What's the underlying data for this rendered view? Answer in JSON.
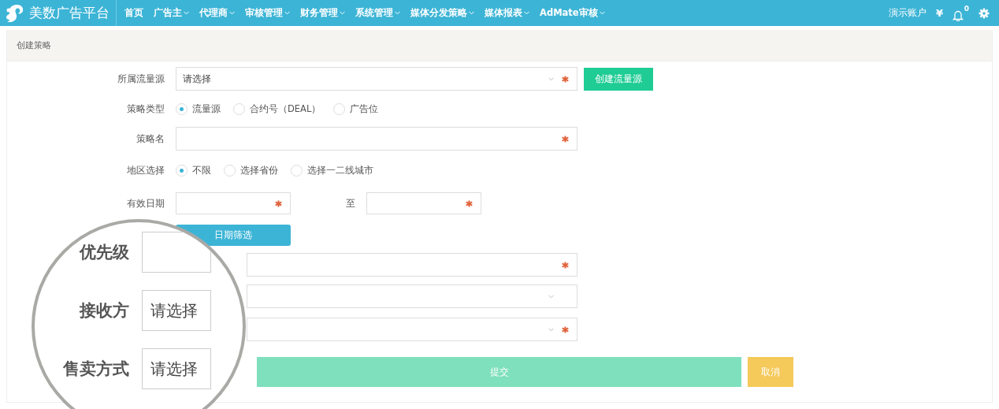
{
  "app": {
    "logo_text": "美数广告平台"
  },
  "nav": [
    {
      "label": "首页",
      "dropdown": false
    },
    {
      "label": "广告主",
      "dropdown": true
    },
    {
      "label": "代理商",
      "dropdown": true
    },
    {
      "label": "审核管理",
      "dropdown": true
    },
    {
      "label": "财务管理",
      "dropdown": true
    },
    {
      "label": "系统管理",
      "dropdown": true
    },
    {
      "label": "媒体分发策略",
      "dropdown": true
    },
    {
      "label": "媒体报表",
      "dropdown": true
    },
    {
      "label": "AdMate审核",
      "dropdown": true
    }
  ],
  "header_right": {
    "account": "演示账户",
    "currency": "¥",
    "notification_count": "0"
  },
  "page_title": "创建策略",
  "form": [
    {
      "kind": "select",
      "label": "所属流量源",
      "placeholder": "请选择",
      "required": true,
      "action": "创建流量源"
    },
    {
      "kind": "radio",
      "label": "策略类型",
      "options": [
        {
          "label": "流量源",
          "selected": true
        },
        {
          "label": "合约号（DEAL）",
          "selected": false
        },
        {
          "label": "广告位",
          "selected": false
        }
      ]
    },
    {
      "kind": "text",
      "label": "策略名",
      "required": true
    },
    {
      "kind": "radio",
      "label": "地区选择",
      "options": [
        {
          "label": "不限",
          "selected": true
        },
        {
          "label": "选择省份",
          "selected": false
        },
        {
          "label": "选择一二线城市",
          "selected": false
        }
      ]
    },
    {
      "kind": "daterange",
      "label": "有效日期",
      "separator": "至",
      "required": true,
      "action": "日期筛选"
    },
    {
      "kind": "text",
      "required": true
    },
    {
      "kind": "select",
      "required": false
    },
    {
      "kind": "select",
      "required": true
    }
  ],
  "buttons": [
    {
      "label": "提交",
      "kind": "primary"
    },
    {
      "label": "取消",
      "kind": "cancel"
    }
  ],
  "magnifier": [
    {
      "label": "优先级"
    },
    {
      "label": "接收方",
      "value": "请选择"
    },
    {
      "label": "售卖方式",
      "value": "请选择"
    }
  ]
}
